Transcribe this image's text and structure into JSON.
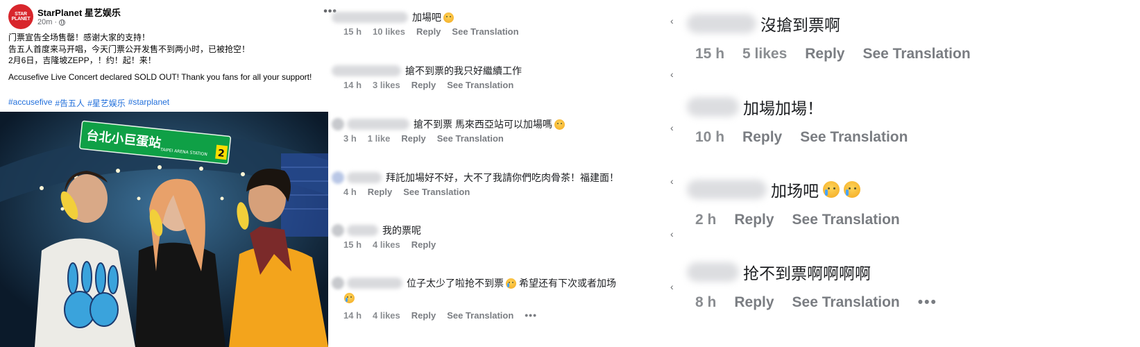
{
  "post": {
    "avatar_text": "STAR PLANET",
    "page_name": "StarPlanet 星艺娱乐",
    "time": "20m",
    "more_label": "•••",
    "lines": [
      "门票宣告全场售罄！感谢大家的支持！",
      "告五人首度来马开唱，今天门票公开发售不到两小时，已被抢空！",
      "2月6日，吉隆坡ZEPP，！约！起！来！"
    ],
    "english": "Accusefive Live Concert declared SOLD OUT! Thank you fans for all your support!",
    "hashtags": [
      "#accusefive",
      "#告五人",
      "#星艺娱乐",
      "#starplanet"
    ],
    "photo": {
      "sign_main": "台北小巨蛋站",
      "sign_sub": "TAIPEI ARENA STATION",
      "sign_num": "2"
    }
  },
  "comments_small": [
    {
      "name_suffix": "vang",
      "text": "加場吧",
      "emoji": "sad",
      "time": "15 h",
      "likes": "10 likes",
      "reply": "Reply",
      "translate": "See Translation",
      "more": ""
    },
    {
      "name_suffix": "h",
      "text": "搶不到票的我只好繼續工作",
      "emoji": "",
      "time": "14 h",
      "likes": "3 likes",
      "reply": "Reply",
      "translate": "See Translation",
      "more": ""
    },
    {
      "name_suffix": "211",
      "text": "搶不到票 馬來西亞站可以加場嗎",
      "emoji": "sad",
      "time": "3 h",
      "likes": "1 like",
      "reply": "Reply",
      "translate": "See Translation",
      "more": ""
    },
    {
      "name_suffix": "v",
      "text": "拜託加場好不好，大不了我請你們吃肉骨茶！福建面！",
      "emoji": "",
      "time": "4 h",
      "likes": "",
      "reply": "Reply",
      "translate": "See Translation",
      "more": ""
    },
    {
      "name_suffix": "h",
      "text": "我的票呢",
      "emoji": "",
      "time": "15 h",
      "likes": "4 likes",
      "reply": "Reply",
      "translate": "",
      "more": ""
    },
    {
      "name_suffix": "28",
      "text": "位子太少了啦抢不到票",
      "text2": "希望还有下次或者加场",
      "emoji": "cry",
      "time": "14 h",
      "likes": "4 likes",
      "reply": "Reply",
      "translate": "See Translation",
      "more": "•••"
    }
  ],
  "comments_large": [
    {
      "name_suffix": "y",
      "text": "沒搶到票啊",
      "time": "15 h",
      "likes": "5 likes",
      "reply": "Reply",
      "translate": "See Translation",
      "more": ""
    },
    {
      "name_suffix": "s",
      "text": "加場加場！",
      "time": "10 h",
      "likes": "",
      "reply": "Reply",
      "translate": "See Translation",
      "more": ""
    },
    {
      "name_suffix": "1",
      "text": "加场吧",
      "time": "2 h",
      "likes": "",
      "reply": "Reply",
      "translate": "See Translation",
      "more": ""
    },
    {
      "name_suffix": "e",
      "text": "抢不到票啊啊啊啊",
      "time": "8 h",
      "likes": "",
      "reply": "Reply",
      "translate": "See Translation",
      "more": "•••"
    }
  ],
  "colors": {
    "hashtag": "#216fdb",
    "brand": "#d8262c",
    "meta": "#8a8d91"
  }
}
